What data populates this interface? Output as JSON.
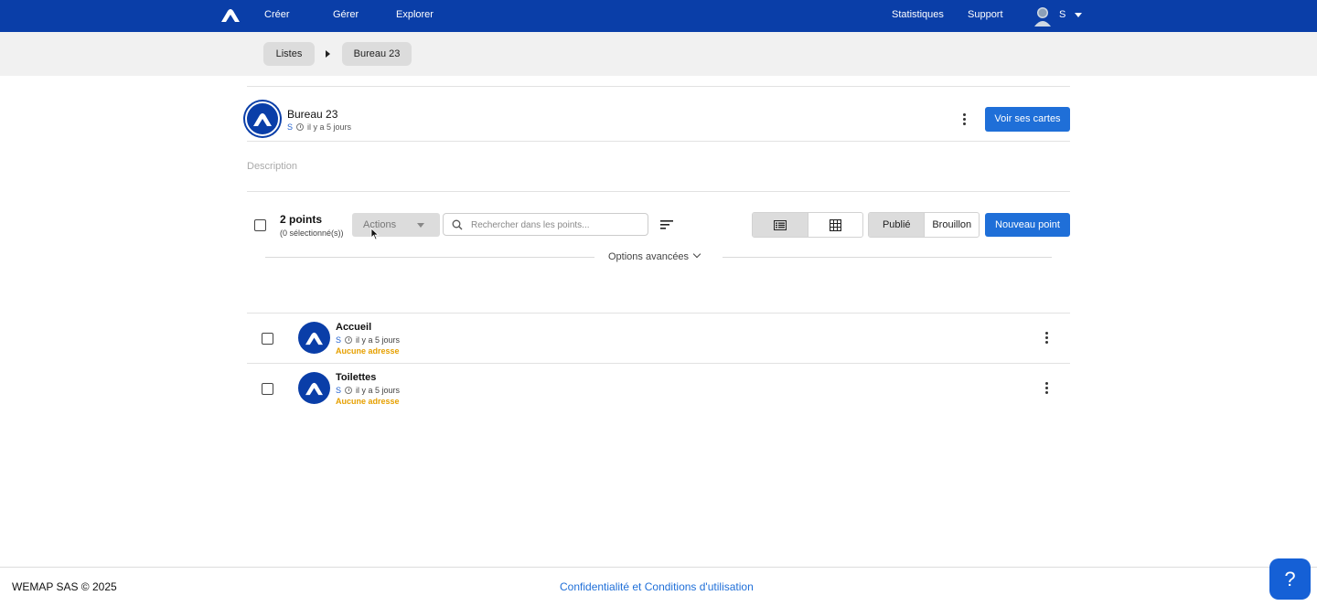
{
  "navbar": {
    "menu": [
      {
        "label": "Créer"
      },
      {
        "label": "Gérer"
      },
      {
        "label": "Explorer"
      }
    ],
    "right": [
      {
        "label": "Statistiques"
      },
      {
        "label": "Support"
      }
    ],
    "user_initial": "S",
    "logo_icon": "wemap-logo-icon",
    "color": "#0a3ea8"
  },
  "breadcrumb": {
    "items": [
      {
        "label": "Listes"
      },
      {
        "label": "Bureau 23"
      }
    ]
  },
  "list": {
    "title": "Bureau 23",
    "author": "S",
    "updated": "il y a 5 jours",
    "view_maps_label": "Voir ses cartes",
    "description_placeholder": "Description"
  },
  "toolbar": {
    "count_label": "2 points",
    "selected_label": "(0 sélectionné(s))",
    "actions_label": "Actions",
    "search_placeholder": "Rechercher dans les points...",
    "status_tabs": [
      {
        "label": "Publié",
        "active": true
      },
      {
        "label": "Brouillon",
        "active": false
      }
    ],
    "new_point_label": "Nouveau point",
    "advanced_options_label": "Options avancées"
  },
  "points": [
    {
      "name": "Accueil",
      "author": "S",
      "updated": "il y a 5 jours",
      "address": "Aucune adresse"
    },
    {
      "name": "Toilettes",
      "author": "S",
      "updated": "il y a 5 jours",
      "address": "Aucune adresse"
    }
  ],
  "footer": {
    "copyright": "WEMAP SAS © 2025",
    "legal_link": "Confidentialité et Conditions d'utilisation",
    "help_label": "?"
  },
  "colors": {
    "primary": "#1f6fd8",
    "warning": "#e6a000",
    "navbar": "#0a3ea8"
  }
}
